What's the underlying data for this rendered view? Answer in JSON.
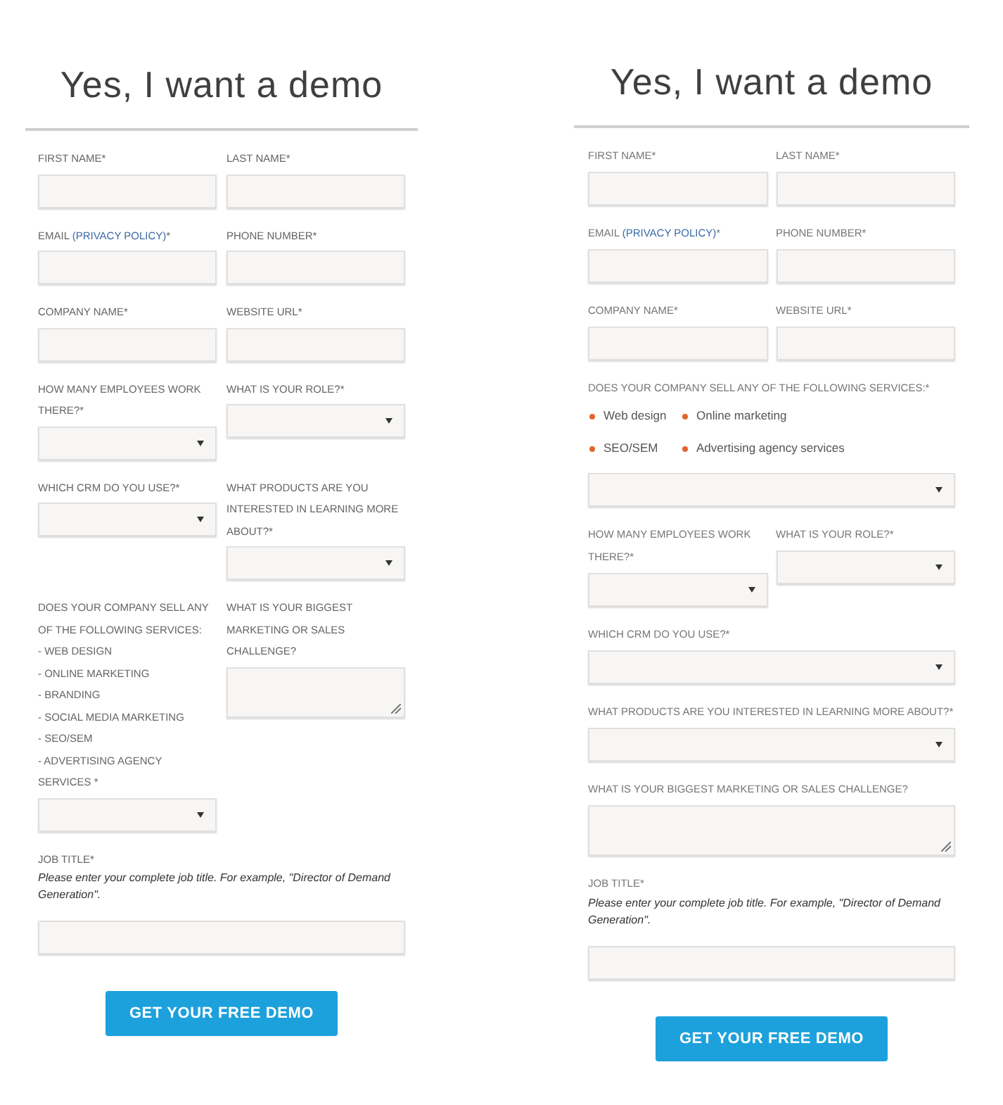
{
  "forms": [
    {
      "title": "Yes, I want a demo",
      "rows": [
        [
          {
            "label": "FIRST NAME*",
            "kind": "input"
          },
          {
            "label": "LAST NAME*",
            "kind": "input"
          }
        ],
        [
          {
            "label": "EMAIL ",
            "link": "(PRIVACY POLICY)",
            "suffix": "*",
            "kind": "input"
          },
          {
            "label": "PHONE NUMBER*",
            "kind": "input"
          }
        ],
        [
          {
            "label": "COMPANY NAME*",
            "kind": "input"
          },
          {
            "label": "WEBSITE URL*",
            "kind": "input"
          }
        ],
        [
          {
            "label": "HOW MANY EMPLOYEES WORK THERE?*",
            "kind": "select"
          },
          {
            "label": "WHAT IS YOUR ROLE?*",
            "kind": "select"
          }
        ],
        [
          {
            "label": "WHICH CRM DO YOU USE?*",
            "kind": "select"
          },
          {
            "label": "WHAT PRODUCTS ARE YOU INTERESTED IN LEARNING MORE ABOUT?*",
            "kind": "select"
          }
        ],
        [
          {
            "label": "DOES YOUR COMPANY SELL ANY OF THE FOLLOWING SERVICES:",
            "items": [
              "- WEB DESIGN",
              "- ONLINE MARKETING",
              "- BRANDING",
              "- SOCIAL MEDIA MARKETING",
              "- SEO/SEM",
              "- ADVERTISING AGENCY SERVICES *"
            ],
            "kind": "select"
          },
          {
            "label": "WHAT IS YOUR BIGGEST MARKETING OR SALES CHALLENGE?",
            "kind": "textarea"
          }
        ],
        [
          {
            "label": "JOB TITLE*",
            "hint": "Please enter your complete job title. For example, \"Director of Demand Generation\".",
            "kind": "input"
          }
        ]
      ],
      "button": "GET YOUR FREE DEMO"
    },
    {
      "title": "Yes, I want a demo",
      "rows": [
        [
          {
            "label": "FIRST NAME*",
            "kind": "input"
          },
          {
            "label": "LAST NAME*",
            "kind": "input"
          }
        ],
        [
          {
            "label": "EMAIL ",
            "link": "(PRIVACY POLICY)",
            "suffix": "*",
            "kind": "input"
          },
          {
            "label": "PHONE NUMBER*",
            "kind": "input"
          }
        ],
        [
          {
            "label": "COMPANY NAME*",
            "kind": "input"
          },
          {
            "label": "WEBSITE URL*",
            "kind": "input"
          }
        ],
        [
          {
            "label": "DOES YOUR COMPANY SELL ANY OF THE FOLLOWING SERVICES:*",
            "bullets": [
              "Web design",
              "Online marketing",
              "SEO/SEM",
              "Advertising agency services"
            ],
            "kind": "select"
          }
        ],
        [
          {
            "label": "HOW MANY EMPLOYEES WORK THERE?*",
            "kind": "select"
          },
          {
            "label": "WHAT IS YOUR ROLE?*",
            "kind": "select"
          }
        ],
        [
          {
            "label": "WHICH CRM DO YOU USE?*",
            "kind": "select"
          }
        ],
        [
          {
            "label": "WHAT PRODUCTS ARE YOU INTERESTED IN LEARNING MORE ABOUT?*",
            "kind": "select"
          }
        ],
        [
          {
            "label": "WHAT IS YOUR BIGGEST MARKETING OR SALES CHALLENGE?",
            "kind": "textarea"
          }
        ],
        [
          {
            "label": "JOB TITLE*",
            "hint": "Please enter your complete job title. For example, \"Director of Demand Generation\".",
            "kind": "input"
          }
        ]
      ],
      "button": "GET YOUR FREE DEMO"
    }
  ]
}
